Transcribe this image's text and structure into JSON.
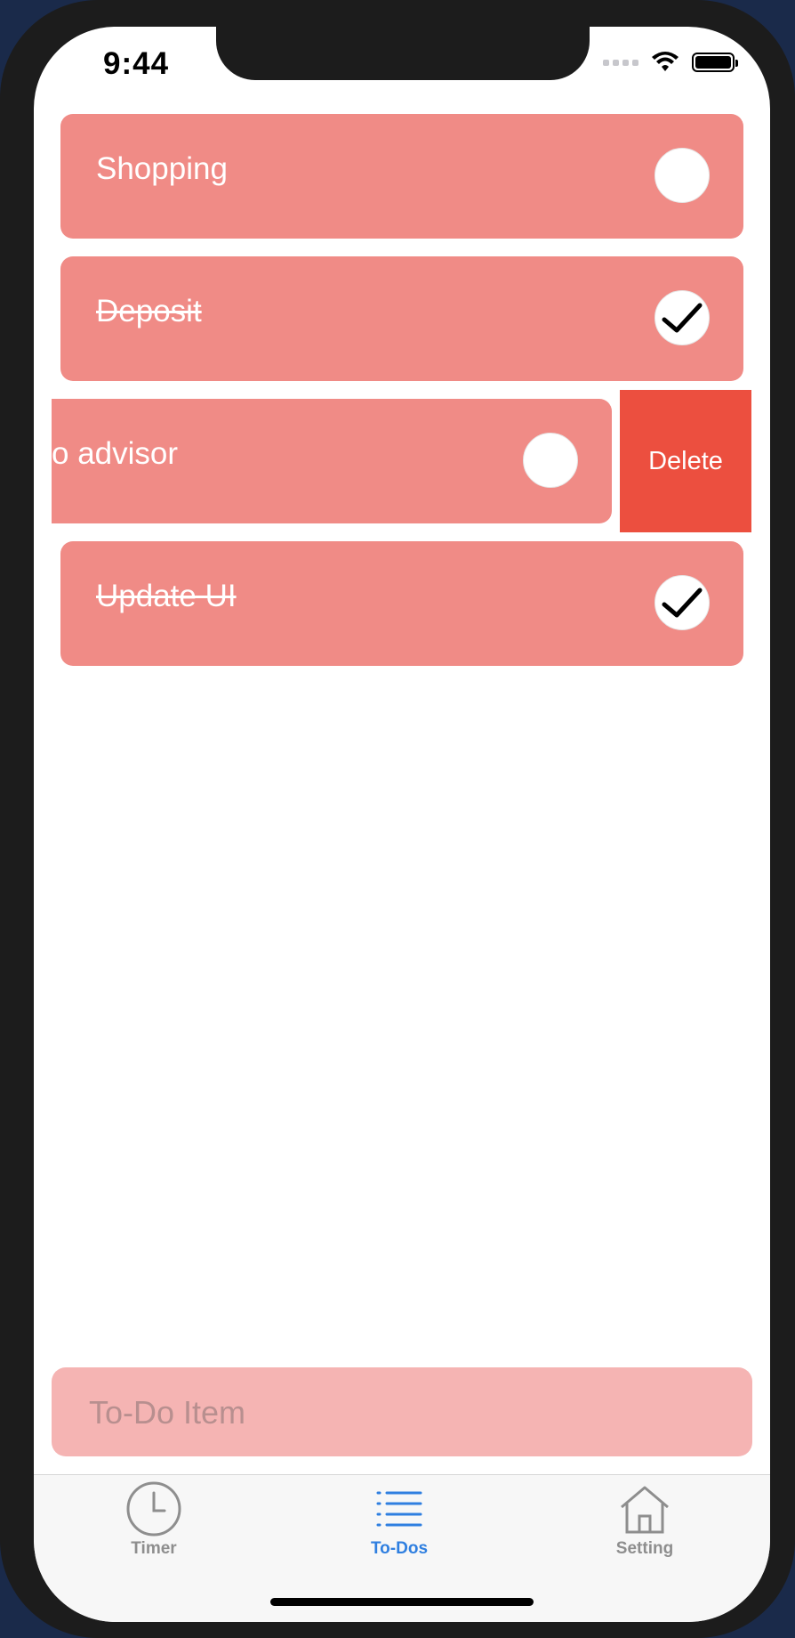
{
  "status_bar": {
    "time": "9:44"
  },
  "todos": [
    {
      "label": "Shopping",
      "done": false
    },
    {
      "label": "Deposit",
      "done": true
    },
    {
      "label": "o advisor",
      "done": false
    },
    {
      "label": "Update UI",
      "done": true
    }
  ],
  "swipe_action": {
    "label": "Delete"
  },
  "input": {
    "placeholder": "To-Do Item"
  },
  "tabs": [
    {
      "label": "Timer",
      "icon": "clock-icon",
      "active": false
    },
    {
      "label": "To-Dos",
      "icon": "list-icon",
      "active": true
    },
    {
      "label": "Setting",
      "icon": "house-icon",
      "active": false
    }
  ],
  "colors": {
    "card": "#f08b86",
    "delete": "#ec4f3f",
    "input_bg": "#f5b4b3",
    "tab_active": "#2f7fe0",
    "tab_inactive": "#8e8e8e"
  }
}
